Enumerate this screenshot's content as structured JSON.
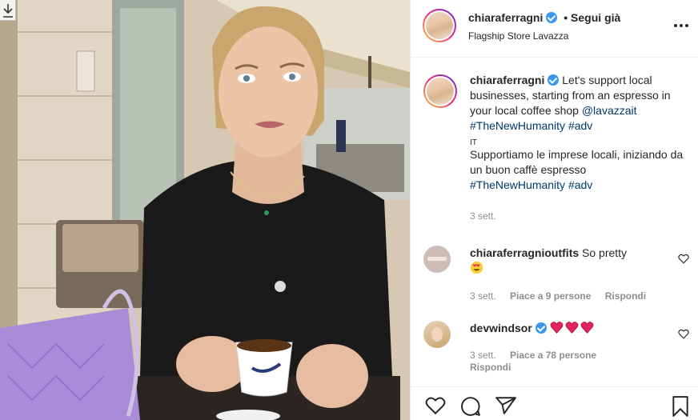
{
  "post": {
    "author": {
      "username": "chiaraferragni",
      "follow_status": "• Segui già",
      "location": "Flagship Store Lavazza"
    },
    "caption": {
      "username": "chiaraferragni",
      "text_en": "Let's support local businesses, starting from an espresso in your local coffee shop",
      "mention": "@lavazzait",
      "hashtags_en": "#TheNewHumanity #adv",
      "language_tag": "IT",
      "text_it": "Supportiamo le imprese locali, iniziando da un buon caffè espresso",
      "hashtags_it": "#TheNewHumanity #adv",
      "time": "3 sett."
    },
    "comments": [
      {
        "username": "chiaraferragnioutfits",
        "text": "So pretty",
        "emoji": "heart-eyes-emoji",
        "time": "3 sett.",
        "likes": "Piace a 9 persone",
        "reply": "Rispondi"
      },
      {
        "username": "devwindsor",
        "text": "",
        "emoji": "three-red-hearts-emoji",
        "time": "3 sett.",
        "likes": "Piace a 78 persone",
        "reply": "Rispondi"
      }
    ]
  },
  "icons": {
    "download": "download-icon",
    "more": "more-options-icon",
    "like": "heart-icon",
    "comment": "comment-icon",
    "share": "share-icon",
    "save": "bookmark-icon"
  },
  "colors": {
    "link": "#00376b",
    "verified": "#3897f0",
    "muted": "#8e8e8e",
    "text": "#262626"
  }
}
